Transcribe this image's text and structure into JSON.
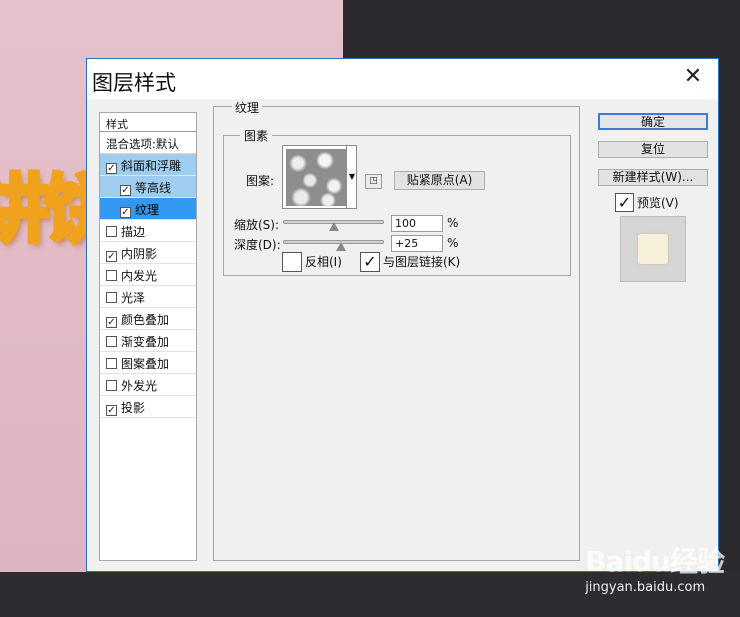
{
  "background": {
    "art_text": "饼",
    "art_text_partial": "讲"
  },
  "dialog": {
    "title": "图层样式",
    "close_glyph": "✕"
  },
  "style_list": {
    "header": "样式",
    "blend_options": "混合选项:默认",
    "items": [
      {
        "label": "斜面和浮雕",
        "checked": true,
        "selected": "light",
        "indent": false
      },
      {
        "label": "等高线",
        "checked": true,
        "selected": "light",
        "indent": true
      },
      {
        "label": "纹理",
        "checked": true,
        "selected": "strong",
        "indent": true
      },
      {
        "label": "描边",
        "checked": false,
        "selected": "none",
        "indent": false
      },
      {
        "label": "内阴影",
        "checked": true,
        "selected": "none",
        "indent": false
      },
      {
        "label": "内发光",
        "checked": false,
        "selected": "none",
        "indent": false
      },
      {
        "label": "光泽",
        "checked": false,
        "selected": "none",
        "indent": false
      },
      {
        "label": "颜色叠加",
        "checked": true,
        "selected": "none",
        "indent": false
      },
      {
        "label": "渐变叠加",
        "checked": false,
        "selected": "none",
        "indent": false
      },
      {
        "label": "图案叠加",
        "checked": false,
        "selected": "none",
        "indent": false
      },
      {
        "label": "外发光",
        "checked": false,
        "selected": "none",
        "indent": false
      },
      {
        "label": "投影",
        "checked": true,
        "selected": "none",
        "indent": false
      }
    ]
  },
  "texture": {
    "section_title": "纹理",
    "group_title": "图素",
    "pattern_label": "图案:",
    "snap_origin_button": "贴紧原点(A)",
    "scale_label": "缩放(S):",
    "scale_value": "100",
    "scale_unit": "%",
    "depth_label": "深度(D):",
    "depth_value": "+25",
    "depth_unit": "%",
    "invert_label": "反相(I)",
    "invert_checked": false,
    "link_label": "与图层链接(K)",
    "link_checked": true
  },
  "right_panel": {
    "ok_button": "确定",
    "reset_button": "复位",
    "new_style_button": "新建样式(W)...",
    "preview_label": "预览(V)",
    "preview_checked": true
  },
  "watermark": {
    "logo": "Baidu经验",
    "url": "jingyan.baidu.com"
  },
  "colors": {
    "selection_light": "#9ecdf0",
    "selection_strong": "#3399f0",
    "dialog_bg": "#f0f0f0",
    "canvas_pink": "#e2bcc8",
    "art_orange": "#f0a21d"
  }
}
